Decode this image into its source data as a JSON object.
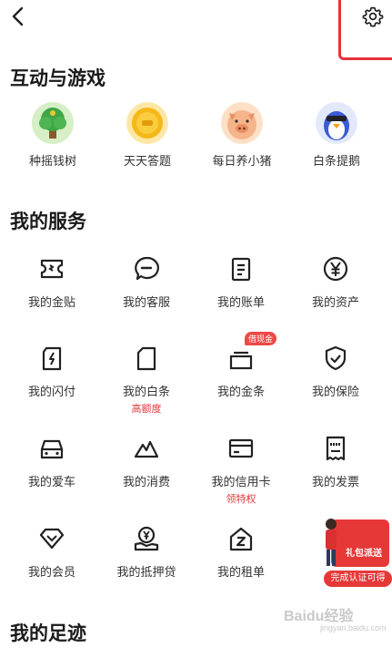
{
  "header": {
    "back_icon": "chevron-left-icon",
    "settings_icon": "gear-icon",
    "highlight_color": "#e8323c"
  },
  "games": {
    "title": "互动与游戏",
    "items": [
      {
        "label": "种摇钱树",
        "icon": "money-tree-icon"
      },
      {
        "label": "天天答题",
        "icon": "gold-coin-quiz-icon"
      },
      {
        "label": "每日养小猪",
        "icon": "pig-icon"
      },
      {
        "label": "白条提鹅",
        "icon": "penguin-icon"
      }
    ]
  },
  "services": {
    "title": "我的服务",
    "items": [
      {
        "label": "我的金贴",
        "icon": "ticket-icon"
      },
      {
        "label": "我的客服",
        "icon": "chat-bubble-icon"
      },
      {
        "label": "我的账单",
        "icon": "bill-icon"
      },
      {
        "label": "我的资产",
        "icon": "yen-icon"
      },
      {
        "label": "我的闪付",
        "icon": "lightning-card-icon"
      },
      {
        "label": "我的白条",
        "icon": "document-icon",
        "sub": "高额度"
      },
      {
        "label": "我的金条",
        "icon": "gold-bar-icon",
        "badge": "借现金"
      },
      {
        "label": "我的保险",
        "icon": "shield-check-icon"
      },
      {
        "label": "我的爱车",
        "icon": "car-icon"
      },
      {
        "label": "我的消费",
        "icon": "mountain-icon"
      },
      {
        "label": "我的信用卡",
        "icon": "credit-card-icon",
        "sub": "领特权"
      },
      {
        "label": "我的发票",
        "icon": "receipt-icon"
      },
      {
        "label": "我的会员",
        "icon": "diamond-icon"
      },
      {
        "label": "我的抵押贷",
        "icon": "yen-hand-icon"
      },
      {
        "label": "我的租单",
        "icon": "house-z-icon"
      }
    ]
  },
  "promo": {
    "card_text": "礼包派送",
    "strip_text": "完成认证可得",
    "color": "#e73838"
  },
  "footprint": {
    "title": "我的足迹"
  },
  "watermark": {
    "text": "Baidu经验",
    "sub": "jingyan.baidu.com"
  },
  "colors": {
    "accent_red": "#e4393c",
    "icon_stroke": "#222222"
  }
}
